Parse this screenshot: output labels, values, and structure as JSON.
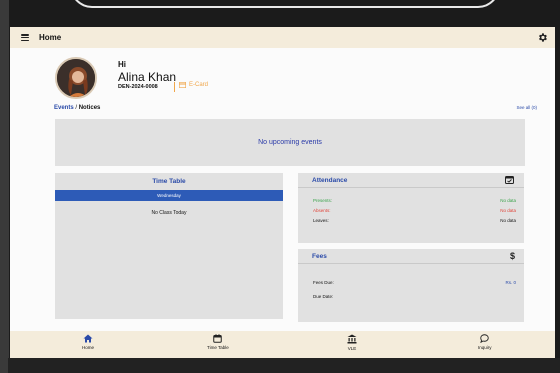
{
  "header": {
    "title": "Home"
  },
  "profile": {
    "greeting": "Hi",
    "name": "Alina Khan",
    "reg_no": "DEN-2024-0008",
    "ecard_label": "E-Card"
  },
  "events": {
    "title_part1": "Events",
    "separator": " / ",
    "title_part2": "Notices",
    "see_all": "See all (0)",
    "empty_message": "No upcoming events"
  },
  "timetable": {
    "title": "Time Table",
    "day": "Wednesday",
    "empty_message": "No Class Today"
  },
  "attendance": {
    "title": "Attendance",
    "rows": [
      {
        "label": "Presents:",
        "value": "No data",
        "color": "#3aa34a"
      },
      {
        "label": "Absents:",
        "value": "No data",
        "color": "#e0453a"
      },
      {
        "label": "Leaves:",
        "value": "No data",
        "color": "#111111"
      }
    ]
  },
  "fees": {
    "title": "Fees",
    "currency_icon": "$",
    "fees_due_label": "Fees Due:",
    "fees_due_value": "Rs. 0",
    "due_date_label": "Due Date:"
  },
  "nav": [
    {
      "label": "Home",
      "icon": "home-icon"
    },
    {
      "label": "Time Table",
      "icon": "calendar-icon"
    },
    {
      "label": "VLE",
      "icon": "institution-icon"
    },
    {
      "label": "Inquiry",
      "icon": "chat-icon"
    }
  ],
  "colors": {
    "accent_blue": "#2a4aa8",
    "header_bg": "#f4ecdb",
    "card_bg": "#e1e1e1",
    "ecard_orange": "#f0a64a",
    "present_green": "#3aa34a",
    "absent_red": "#e0453a"
  }
}
